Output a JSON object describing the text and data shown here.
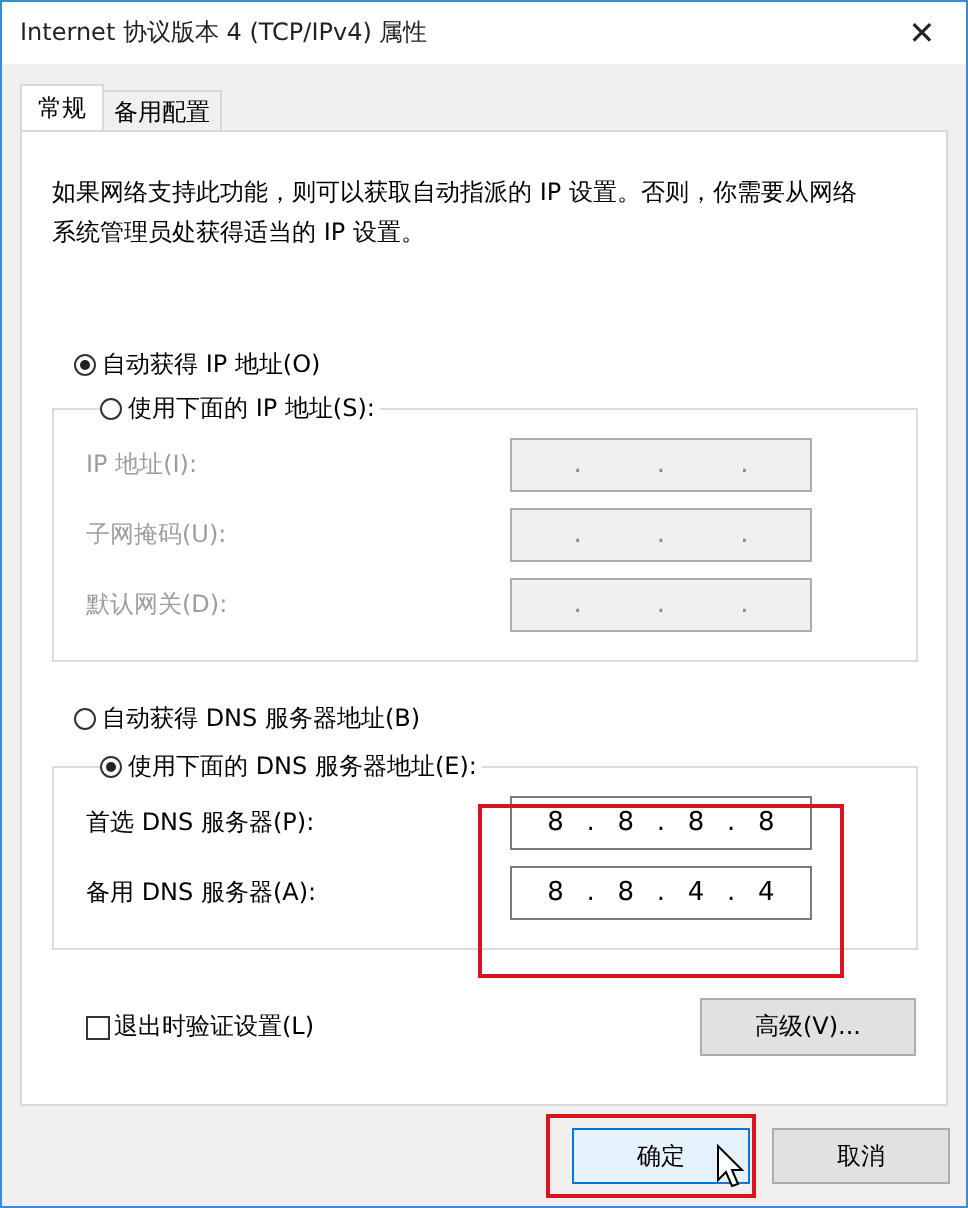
{
  "window": {
    "title": "Internet 协议版本 4 (TCP/IPv4) 属性",
    "close": "✕"
  },
  "tabs": [
    {
      "label": "常规",
      "selected": true
    },
    {
      "label": "备用配置",
      "selected": false
    }
  ],
  "description": "如果网络支持此功能，则可以获取自动指派的 IP 设置。否则，你需要从网络系统管理员处获得适当的 IP 设置。",
  "ip": {
    "auto_option": {
      "label": "自动获得 IP 地址(O)",
      "selected": true
    },
    "manual_option": {
      "label": "使用下面的 IP 地址(S):",
      "selected": false
    },
    "disabled": true,
    "fields": [
      {
        "label": "IP 地址(I):",
        "parts": [
          ".",
          ".",
          "."
        ]
      },
      {
        "label": "子网掩码(U):",
        "parts": [
          ".",
          ".",
          "."
        ]
      },
      {
        "label": "默认网关(D):",
        "parts": [
          ".",
          ".",
          "."
        ]
      }
    ]
  },
  "dns": {
    "auto_option": {
      "label": "自动获得 DNS 服务器地址(B)",
      "selected": false
    },
    "manual_option": {
      "label": "使用下面的 DNS 服务器地址(E):",
      "selected": true
    },
    "disabled": false,
    "highlighted": true,
    "fields": [
      {
        "label": "首选 DNS 服务器(P):",
        "parts": [
          "8",
          ".",
          "8",
          ".",
          "8",
          ".",
          "8"
        ]
      },
      {
        "label": "备用 DNS 服务器(A):",
        "parts": [
          "8",
          ".",
          "8",
          ".",
          "4",
          ".",
          "4"
        ]
      }
    ]
  },
  "validate_checkbox": {
    "label": "退出时验证设置(L)",
    "checked": false
  },
  "advanced_button": "高级(V)...",
  "buttons": [
    {
      "label": "确定",
      "kind": "default",
      "highlighted": true
    },
    {
      "label": "取消",
      "kind": "normal",
      "highlighted": false
    }
  ]
}
